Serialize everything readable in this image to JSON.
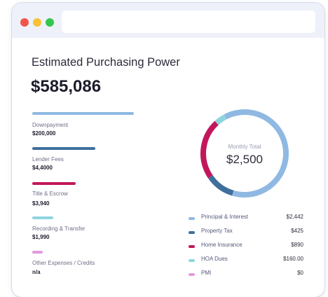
{
  "window": {
    "traffic_lights": [
      "close",
      "minimize",
      "maximize"
    ]
  },
  "summary": {
    "title": "Estimated Purchasing Power",
    "amount": "$585,086"
  },
  "costs": [
    {
      "label": "Downpayment",
      "value": "$200,000",
      "color": "#8fb9e2"
    },
    {
      "label": "Lender Fees",
      "value": "$4,4000",
      "color": "#3f6f9c"
    },
    {
      "label": "Title & Escrow",
      "value": "$3,940",
      "color": "#c2185b"
    },
    {
      "label": "Recording & Transfer",
      "value": "$1,990",
      "color": "#8ed6de"
    },
    {
      "label": "Other Expenses / Credits",
      "value": "n/a",
      "color": "#e29ae0"
    }
  ],
  "monthly": {
    "label": "Monthly Total",
    "value": "$2,500"
  },
  "breakdown": [
    {
      "label": "Principal & Interest",
      "value": "$2,442",
      "color": "#8fb9e2"
    },
    {
      "label": "Property Tax",
      "value": "$425",
      "color": "#3f6f9c"
    },
    {
      "label": "Home Insurance",
      "value": "$890",
      "color": "#c2185b"
    },
    {
      "label": "HOA Dues",
      "value": "$160.00",
      "color": "#8ed6de"
    },
    {
      "label": "PMI",
      "value": "$0",
      "color": "#e29ae0"
    }
  ],
  "colors": {
    "accent_blue": "#8fb9e2",
    "dark_blue": "#3f6f9c",
    "magenta": "#c2185b",
    "teal": "#8ed6de",
    "pink": "#e29ae0"
  }
}
